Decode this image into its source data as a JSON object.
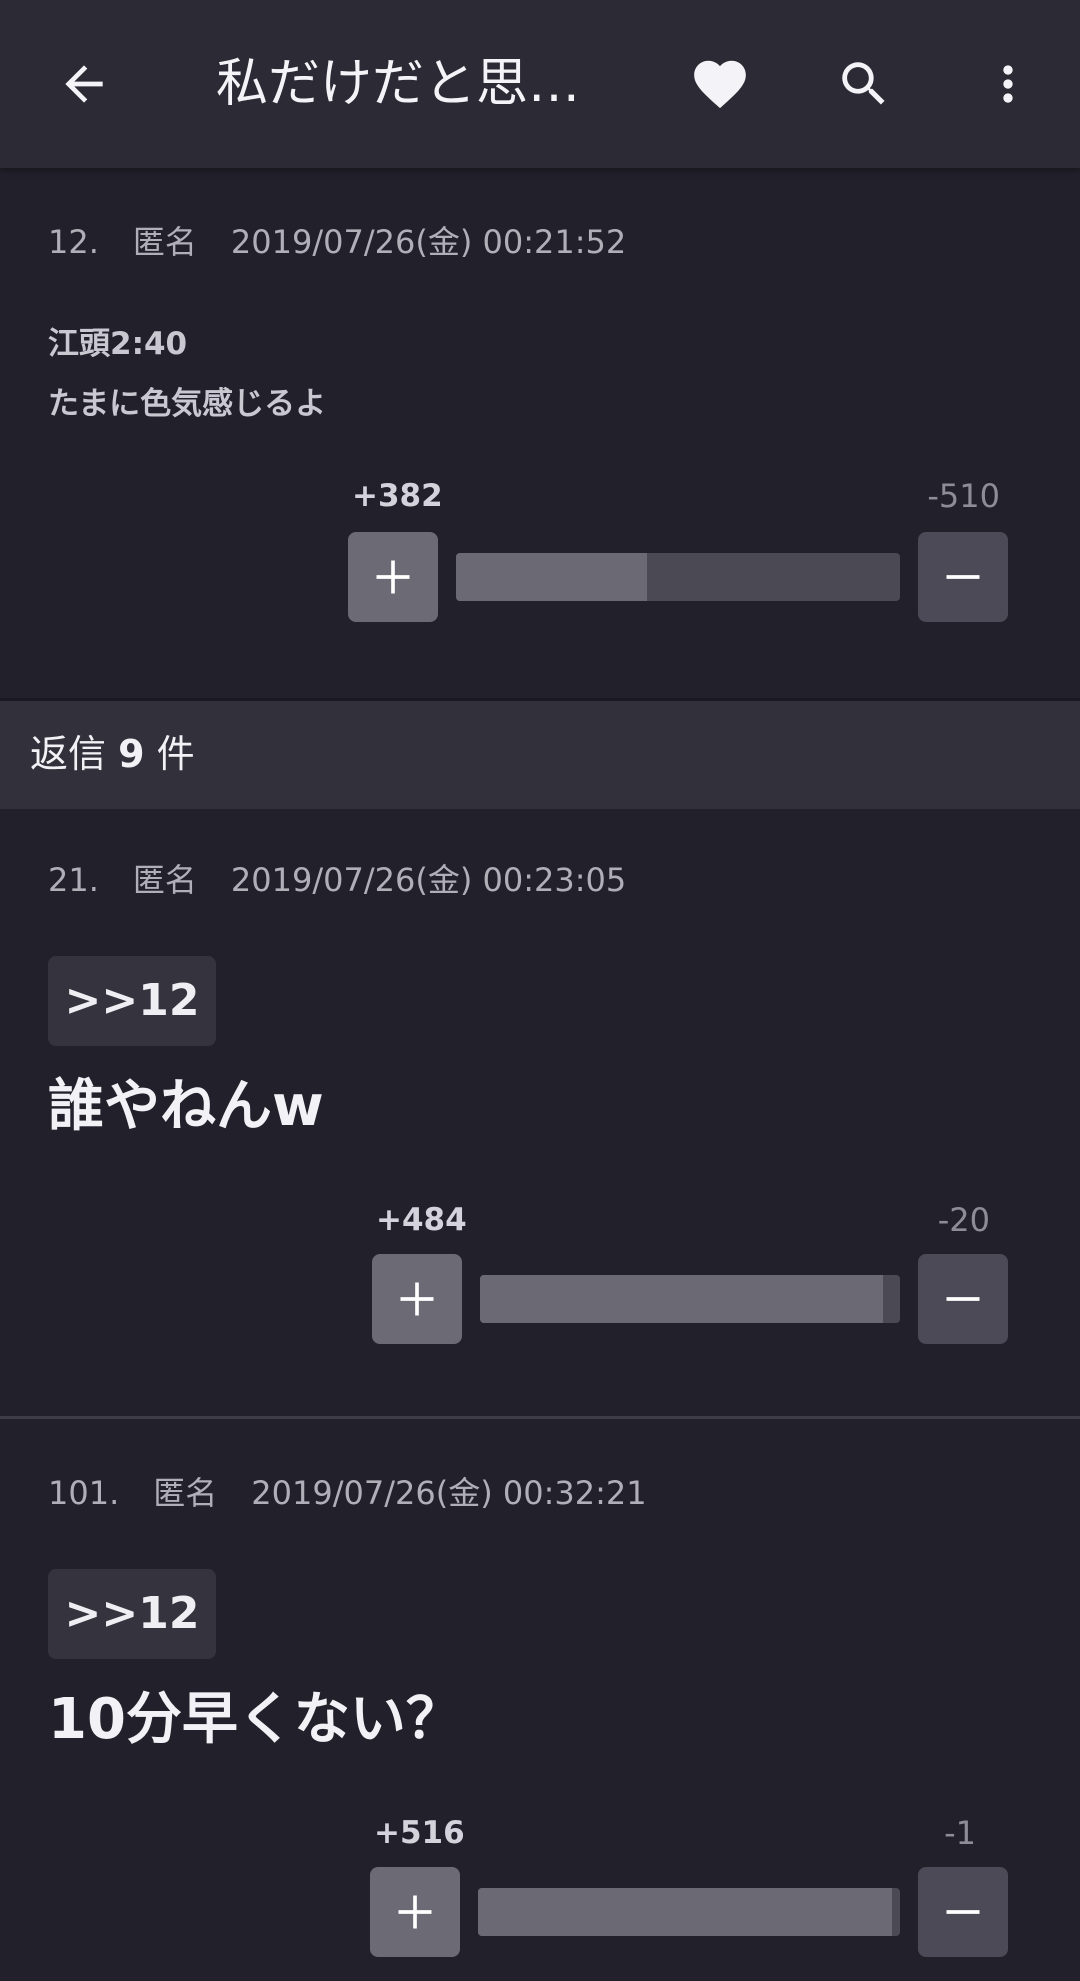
{
  "appbar": {
    "title": "私だけだと思…",
    "icons": [
      "arrow-left-icon",
      "heart-icon",
      "search-icon",
      "more-vert-icon"
    ]
  },
  "comments": [
    {
      "number": "12.",
      "author": "匿名",
      "datetime": "2019/07/26(金) 00:21:52",
      "lines": [
        "江頭2:40",
        "たまに色気感じるよ"
      ],
      "plus": "+382",
      "minus": "-510",
      "ratio": 0.43
    },
    {
      "number": "21.",
      "author": "匿名",
      "datetime": "2019/07/26(金) 00:23:05",
      "anchor": ">>12",
      "text": "誰やねんw",
      "plus": "+484",
      "minus": "-20",
      "ratio": 0.96
    },
    {
      "number": "101.",
      "author": "匿名",
      "datetime": "2019/07/26(金) 00:32:21",
      "anchor": ">>12",
      "text": "10分早くない？",
      "plus": "+516",
      "minus": "-1",
      "ratio": 0.98
    }
  ],
  "replies": {
    "prefix": "返信",
    "count": "9",
    "suffix": "件"
  },
  "colors": {
    "background": "#22212b",
    "appbar": "#2c2b35",
    "vote_plus": "#6b6a75",
    "vote_minus": "#4b4a56"
  }
}
